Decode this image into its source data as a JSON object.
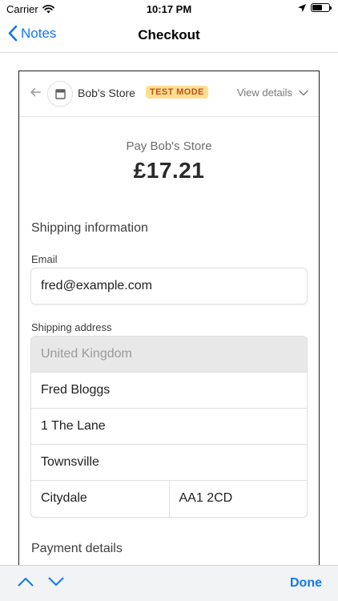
{
  "status_bar": {
    "carrier": "Carrier",
    "time": "10:17 PM",
    "battery_level": 0.6
  },
  "nav": {
    "back_label": "Notes",
    "title": "Checkout"
  },
  "sheet_header": {
    "store_name": "Bob's Store",
    "badge": "TEST MODE",
    "view_details": "View details"
  },
  "summary": {
    "pay_title": "Pay Bob's Store",
    "amount": "£17.21"
  },
  "shipping": {
    "section_title": "Shipping information",
    "email_label": "Email",
    "email_value": "fred@example.com",
    "address_label": "Shipping address",
    "country": "United Kingdom",
    "name": "Fred Bloggs",
    "line1": "1 The Lane",
    "city": "Townsville",
    "locality": "Citydale",
    "postcode": "AA1 2CD"
  },
  "payment": {
    "section_title": "Payment details"
  },
  "toolbar": {
    "done_label": "Done"
  },
  "colors": {
    "accent": "#1478e6",
    "badge_bg": "#ffde92",
    "badge_text": "#b8531a"
  }
}
